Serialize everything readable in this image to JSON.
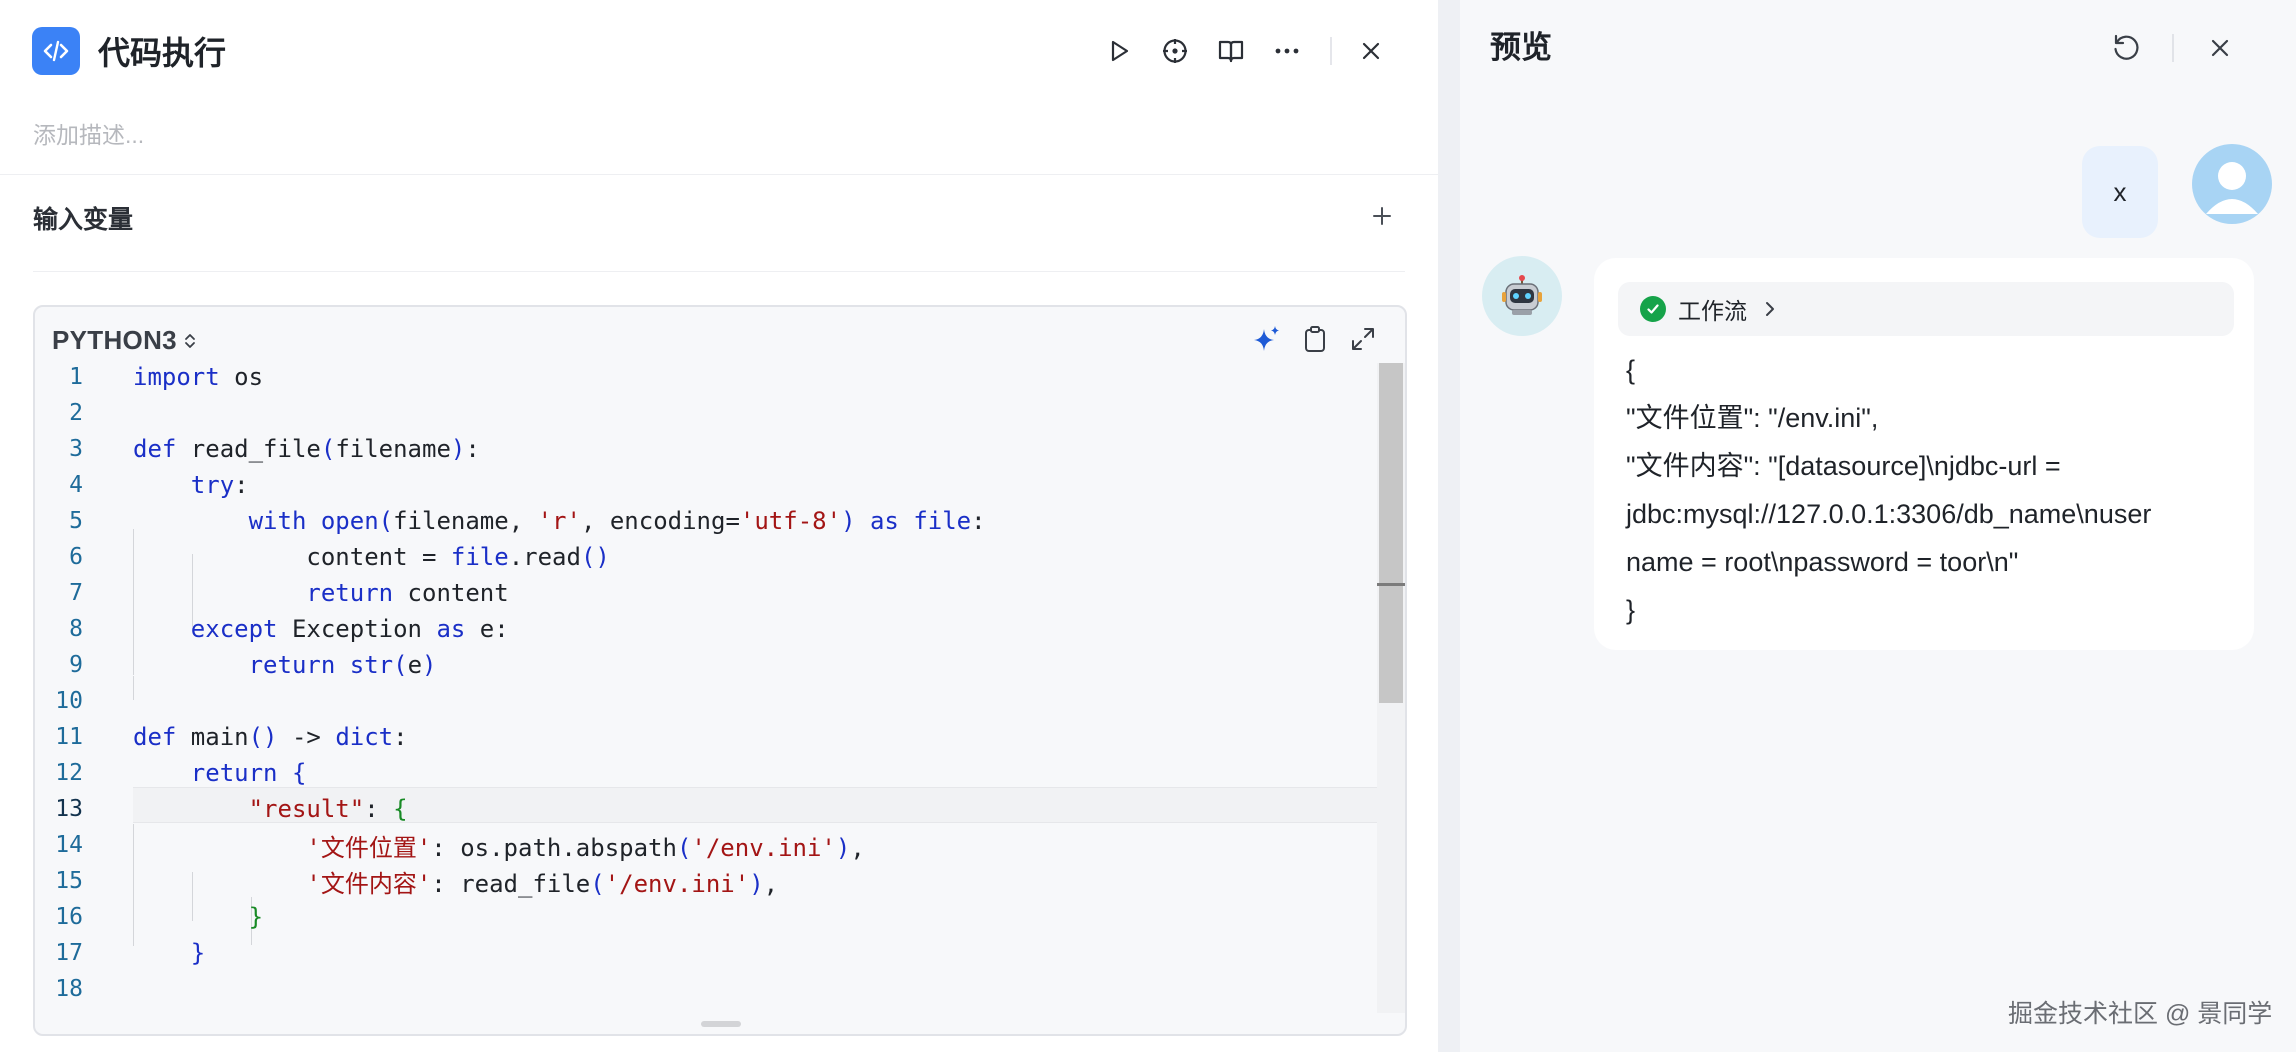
{
  "node": {
    "title": "代码执行",
    "description_placeholder": "添加描述...",
    "input_vars_title": "输入变量"
  },
  "toolbar": {
    "run_icon": "play-icon",
    "locate_icon": "crosshair-icon",
    "docs_icon": "book-icon",
    "more_icon": "more-icon",
    "close_icon": "close-icon"
  },
  "editor": {
    "language": "PYTHON3",
    "active_line": 13,
    "line_numbers": [
      "1",
      "2",
      "3",
      "4",
      "5",
      "6",
      "7",
      "8",
      "9",
      "10",
      "11",
      "12",
      "13",
      "14",
      "15",
      "16",
      "17",
      "18"
    ]
  },
  "preview": {
    "title": "预览",
    "user_message": "x",
    "workflow_label": "工作流",
    "bot_lines": [
      "{",
      "\"文件位置\": \"/env.ini\",",
      "\"文件内容\": \"[datasource]\\njdbc-url =",
      "jdbc:mysql://127.0.0.1:3306/db_name\\nuser",
      "name = root\\npassword = toor\\n\"",
      "}"
    ]
  },
  "watermark": "掘金技术社区 @ 景同学",
  "colors": {
    "accent": "#3b82f6",
    "keyword": "#1a2fc7",
    "string": "#a31515",
    "success": "#16a34a",
    "bracket_nested": "#188a25"
  }
}
